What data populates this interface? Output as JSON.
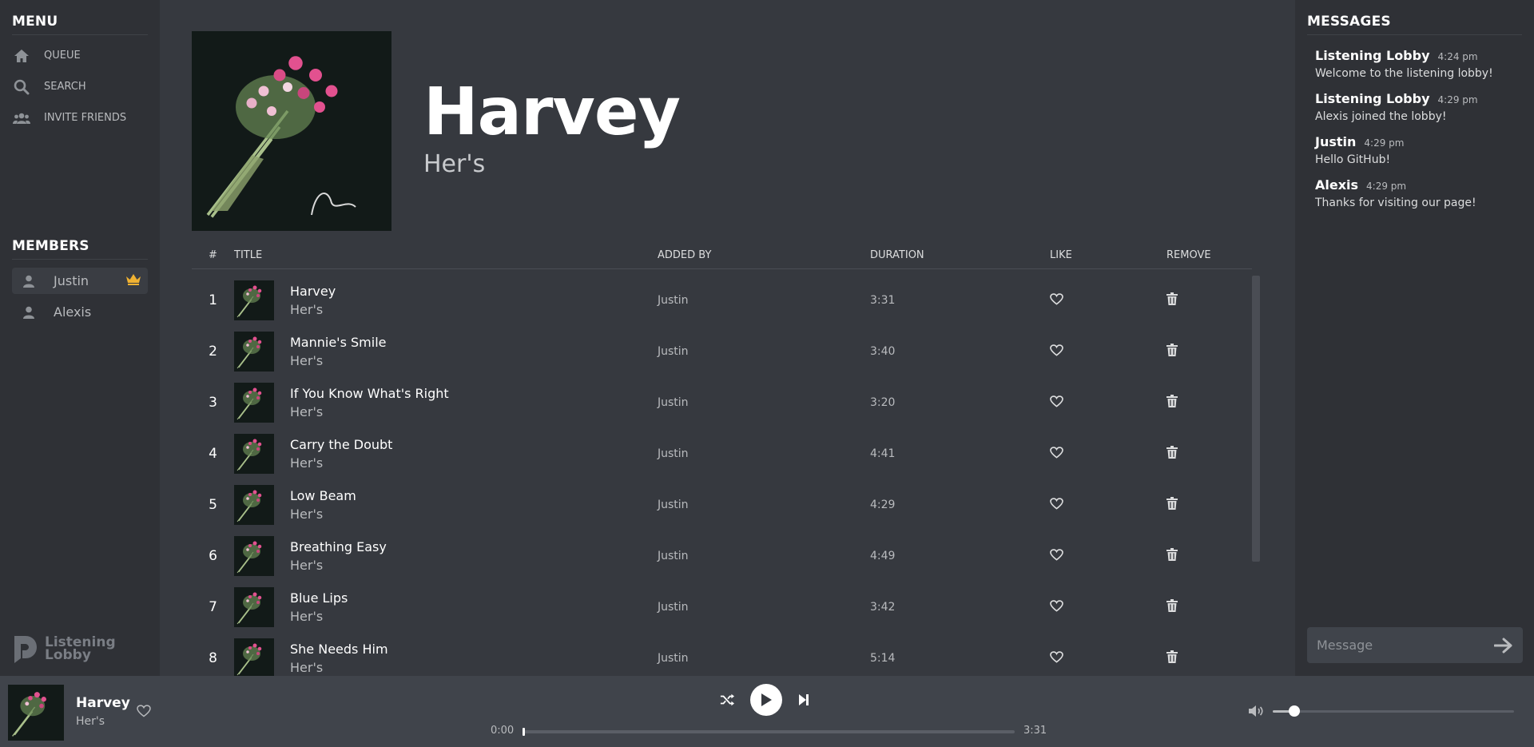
{
  "menu": {
    "title": "MENU",
    "items": [
      {
        "label": "QUEUE",
        "icon": "home-icon"
      },
      {
        "label": "SEARCH",
        "icon": "search-icon"
      },
      {
        "label": "INVITE FRIENDS",
        "icon": "users-icon"
      }
    ]
  },
  "members": {
    "title": "MEMBERS",
    "items": [
      {
        "name": "Justin",
        "host": true
      },
      {
        "name": "Alexis",
        "host": false
      }
    ]
  },
  "logo": {
    "line1": "Listening",
    "line2": "Lobby"
  },
  "now": {
    "title": "Harvey",
    "artist": "Her's"
  },
  "table": {
    "headers": {
      "num": "#",
      "title": "TITLE",
      "added_by": "ADDED BY",
      "duration": "DURATION",
      "like": "LIKE",
      "remove": "REMOVE"
    },
    "rows": [
      {
        "num": "1",
        "title": "Harvey",
        "artist": "Her's",
        "added_by": "Justin",
        "duration": "3:31"
      },
      {
        "num": "2",
        "title": "Mannie's Smile",
        "artist": "Her's",
        "added_by": "Justin",
        "duration": "3:40"
      },
      {
        "num": "3",
        "title": "If You Know What's Right",
        "artist": "Her's",
        "added_by": "Justin",
        "duration": "3:20"
      },
      {
        "num": "4",
        "title": "Carry the Doubt",
        "artist": "Her's",
        "added_by": "Justin",
        "duration": "4:41"
      },
      {
        "num": "5",
        "title": "Low Beam",
        "artist": "Her's",
        "added_by": "Justin",
        "duration": "4:29"
      },
      {
        "num": "6",
        "title": "Breathing Easy",
        "artist": "Her's",
        "added_by": "Justin",
        "duration": "4:49"
      },
      {
        "num": "7",
        "title": "Blue Lips",
        "artist": "Her's",
        "added_by": "Justin",
        "duration": "3:42"
      },
      {
        "num": "8",
        "title": "She Needs Him",
        "artist": "Her's",
        "added_by": "Justin",
        "duration": "5:14"
      }
    ]
  },
  "messages": {
    "title": "MESSAGES",
    "items": [
      {
        "user": "Listening Lobby",
        "time": "4:24 pm",
        "text": "Welcome to the listening lobby!"
      },
      {
        "user": "Listening Lobby",
        "time": "4:29 pm",
        "text": "Alexis joined the lobby!"
      },
      {
        "user": "Justin",
        "time": "4:29 pm",
        "text": "Hello GitHub!"
      },
      {
        "user": "Alexis",
        "time": "4:29 pm",
        "text": "Thanks for visiting our page!"
      }
    ],
    "input_placeholder": "Message"
  },
  "player": {
    "title": "Harvey",
    "artist": "Her's",
    "elapsed": "0:00",
    "total": "3:31",
    "progress_fraction": 0.0,
    "volume_fraction": 0.09
  },
  "colors": {
    "accent_crown": "#f0b232",
    "background": "#36393f",
    "panel": "#2f3136",
    "bar": "#40444b"
  }
}
